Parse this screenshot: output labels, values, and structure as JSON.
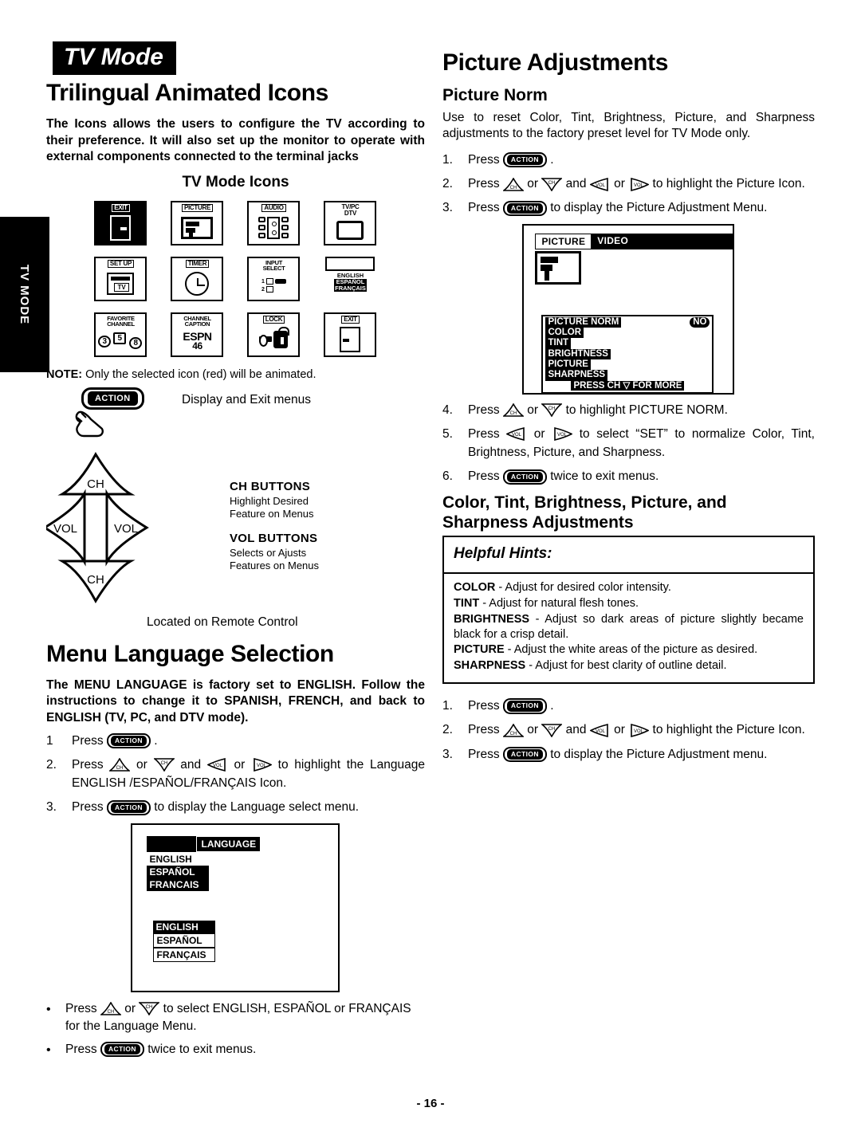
{
  "side_tab": {
    "label": "TV MODE"
  },
  "mode_badge": "TV Mode",
  "page_number": "- 16 -",
  "left": {
    "title": "Trilingual Animated Icons",
    "intro": "The Icons allows the users to configure the TV according to their preference. It will also set up the monitor to operate with external components connected to the terminal jacks",
    "icons_heading": "TV Mode Icons",
    "icons": [
      {
        "name": "exit-icon",
        "caption": "EXIT",
        "style": "inverted"
      },
      {
        "name": "picture-icon",
        "caption": "PICTURE",
        "style": "normal"
      },
      {
        "name": "audio-icon",
        "caption": "AUDIO",
        "style": "normal"
      },
      {
        "name": "tv-pc-dtv-icon",
        "caption": "TV/PC",
        "caption2": "DTV",
        "style": "normal"
      },
      {
        "name": "set-up-icon",
        "caption": "SET UP",
        "sub": "TV",
        "style": "normal"
      },
      {
        "name": "timer-icon",
        "caption": "TIMER",
        "style": "normal"
      },
      {
        "name": "input-select-icon",
        "caption": "INPUT",
        "caption2": "SELECT",
        "in1": "1",
        "in2": "2",
        "style": "normal"
      },
      {
        "name": "language-icon",
        "caption": "",
        "l1": "ENGLISH",
        "l2": "ESPAÑOL",
        "l3": "FRANÇAIS",
        "style": "normal"
      },
      {
        "name": "favorite-channel-icon",
        "caption": "FAVORITE",
        "caption2": "CHANNEL",
        "n1": "3",
        "n2": "5",
        "n3": "8",
        "style": "normal"
      },
      {
        "name": "channel-caption-icon",
        "caption": "CHANNEL",
        "caption2": "CAPTION",
        "call": "ESPN",
        "num": "46",
        "style": "normal"
      },
      {
        "name": "lock-icon",
        "caption": "LOCK",
        "style": "normal"
      },
      {
        "name": "exit-icon-2",
        "caption": "EXIT",
        "style": "normal"
      }
    ],
    "note_label": "NOTE:",
    "note_text": " Only the selected icon (red) will be animated.",
    "action_label": "ACTION",
    "action_desc": "Display and Exit menus",
    "remote": {
      "ch_up": "CH",
      "ch_down": "CH",
      "vol_left": "VOL",
      "vol_right": "VOL",
      "ch_heading": "CH  BUTTONS",
      "ch_body_1": "Highlight Desired",
      "ch_body_2": "Feature on Menus",
      "vol_heading": "VOL  BUTTONS",
      "vol_body_1": "Selects or Ajusts",
      "vol_body_2": "Features on Menus",
      "located": "Located on Remote Control"
    },
    "lang_title": "Menu Language Selection",
    "lang_intro": "The MENU LANGUAGE is factory set to ENGLISH. Follow the instructions to change it to SPANISH, FRENCH, and back to ENGLISH (TV, PC, and DTV mode).",
    "lang_steps": [
      {
        "num": "1",
        "pre": "Press ",
        "post": " ."
      },
      {
        "num": "2.",
        "pre": "Press ",
        "post": " to highlight the Language ENGLISH /ESPAÑOL/FRANÇAIS Icon.",
        "arrows": "four"
      },
      {
        "num": "3.",
        "pre": "Press ",
        "post": " to display the Language select menu."
      }
    ],
    "lang_osd": {
      "title": "LANGUAGE",
      "top_items": [
        "ENGLISH",
        "ESPAÑOL",
        "FRANCAIS"
      ],
      "bottom_items": [
        "ENGLISH",
        "ESPAÑOL",
        "FRANÇAIS"
      ]
    },
    "lang_bullets": [
      {
        "pre": "Press ",
        "post": " to select ENGLISH, ESPAÑOL or FRANÇAIS for the Language Menu.",
        "arrows": "ch"
      },
      {
        "pre": "Press ",
        "post": " twice to exit menus.",
        "arrows": "action"
      }
    ]
  },
  "right": {
    "title": "Picture Adjustments",
    "norm_title": "Picture Norm",
    "norm_body": "Use to reset Color, Tint, Brightness, Picture, and Sharpness adjustments to the factory preset level for TV Mode only.",
    "steps_a": [
      {
        "num": "1.",
        "pre": "Press ",
        "post": " .",
        "arrows": "action"
      },
      {
        "num": "2.",
        "pre": "Press ",
        "post": " to highlight the Picture Icon.",
        "arrows": "four"
      },
      {
        "num": "3.",
        "pre": "Press ",
        "post": " to display the Picture Adjustment Menu.",
        "arrows": "action"
      }
    ],
    "picture_osd": {
      "tab_selected": "PICTURE",
      "tab_other": "VIDEO",
      "menu_rows": [
        {
          "label": "PICTURE NORM",
          "value": "NO"
        },
        {
          "label": "COLOR",
          "value": ""
        },
        {
          "label": "TINT",
          "value": ""
        },
        {
          "label": "BRIGHTNESS",
          "value": ""
        },
        {
          "label": "PICTURE",
          "value": ""
        },
        {
          "label": "SHARPNESS",
          "value": ""
        }
      ],
      "footer": "PRESS CH ▽ FOR MORE"
    },
    "steps_b": [
      {
        "num": "4.",
        "pre": "Press ",
        "post": " to highlight PICTURE NORM.",
        "arrows": "ch"
      },
      {
        "num": "5.",
        "pre": "Press ",
        "post": " to select “SET” to normalize Color, Tint, Brightness, Picture, and Sharpness.",
        "arrows": "vol"
      },
      {
        "num": "6.",
        "pre": "Press ",
        "post": " twice to exit menus.",
        "arrows": "action"
      }
    ],
    "adj_title_1": "Color, Tint, Brightness, Picture, and",
    "adj_title_2": "Sharpness Adjustments",
    "hints_title": "Helpful Hints:",
    "hints": [
      {
        "term": "COLOR",
        "text": " - Adjust for desired color intensity."
      },
      {
        "term": "TINT",
        "text": " - Adjust for natural flesh tones."
      },
      {
        "term": "BRIGHTNESS",
        "text": " - Adjust so dark areas of picture slightly became black for a crisp detail."
      },
      {
        "term": "PICTURE",
        "text": " - Adjust the white areas of the picture as desired."
      },
      {
        "term": "SHARPNESS",
        "text": " - Adjust for best clarity of outline detail."
      }
    ],
    "steps_c": [
      {
        "num": "1.",
        "pre": "Press ",
        "post": " .",
        "arrows": "action"
      },
      {
        "num": "2.",
        "pre": "Press ",
        "post": " to highlight the Picture Icon.",
        "arrows": "four"
      },
      {
        "num": "3.",
        "pre": "Press ",
        "post": " to display the Picture Adjustment menu.",
        "arrows": "action"
      }
    ]
  }
}
